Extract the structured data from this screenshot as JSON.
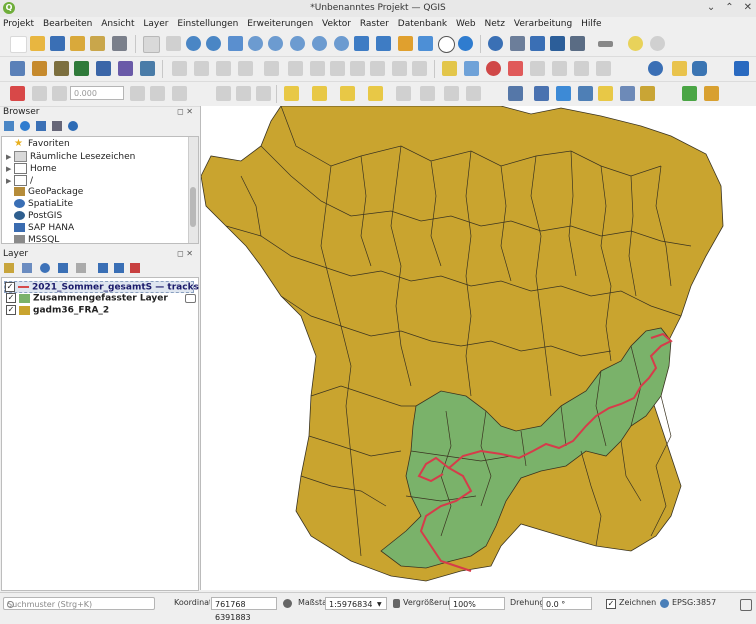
{
  "window": {
    "title": "*Unbenanntes Projekt — QGIS",
    "logo": "Q"
  },
  "menu": [
    "Projekt",
    "Bearbeiten",
    "Ansicht",
    "Layer",
    "Einstellungen",
    "Erweiterungen",
    "Vektor",
    "Raster",
    "Datenbank",
    "Web",
    "Netz",
    "Verarbeitung",
    "Hilfe"
  ],
  "toolbar": {
    "scale_box": "0.000"
  },
  "browser": {
    "title": "Browser",
    "items": [
      {
        "label": "Favoriten",
        "icon": "star-icon"
      },
      {
        "label": "Räumliche Lesezeichen",
        "icon": "bookmark-icon"
      },
      {
        "label": "Home",
        "icon": "home-folder-icon"
      },
      {
        "label": "/",
        "icon": "root-folder-icon"
      },
      {
        "label": "GeoPackage",
        "icon": "geopackage-icon"
      },
      {
        "label": "SpatiaLite",
        "icon": "spatialite-icon"
      },
      {
        "label": "PostGIS",
        "icon": "postgis-icon"
      },
      {
        "label": "SAP HANA",
        "icon": "saphana-icon"
      },
      {
        "label": "MSSQL",
        "icon": "mssql-icon"
      }
    ]
  },
  "layers": {
    "title": "Layer",
    "items": [
      {
        "label": "2021_Sommer_gesamtS — tracks",
        "checked": true,
        "color": "#d64a4a"
      },
      {
        "label": "Zusammengefasster Layer",
        "checked": true,
        "color": "#7ab26a"
      },
      {
        "label": "gadm36_FRA_2",
        "checked": true,
        "color": "#c9a42f"
      }
    ]
  },
  "map": {
    "country_color": "#c9a42f",
    "merged_color": "#7ab26a",
    "track_color": "#d63c4a",
    "border_color": "#3a3320"
  },
  "status": {
    "search_placeholder": "Suchmuster (Strg+K)",
    "coord_label": "Koordinate",
    "coord_value": "761768 6391883",
    "scale_label": "Maßstab",
    "scale_value": "1:5976834",
    "magnifier_label": "Vergrößerung",
    "magnifier_value": "100%",
    "rotation_label": "Drehung",
    "rotation_value": "0.0 °",
    "render_label": "Zeichnen",
    "crs": "EPSG:3857"
  },
  "colors": {
    "accent": "#3b73b9"
  }
}
